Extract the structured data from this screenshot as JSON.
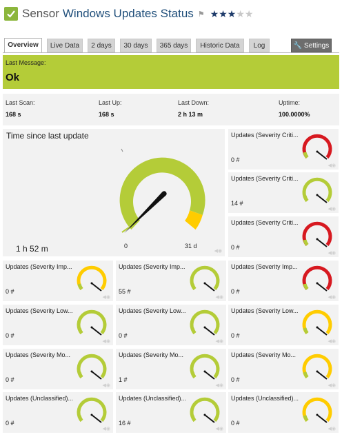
{
  "header": {
    "prefix": "Sensor",
    "name": "Windows Updates Status",
    "stars_filled": 3,
    "stars_total": 5,
    "status": "up",
    "status_color": "#8cb63c"
  },
  "tabs": [
    {
      "label": "Overview",
      "active": true
    },
    {
      "label": "Live Data"
    },
    {
      "label": "2 days"
    },
    {
      "label": "30 days"
    },
    {
      "label": "365 days"
    },
    {
      "label": "Historic Data"
    },
    {
      "label": "Log"
    },
    {
      "label": "Settings",
      "icon": "wrench-icon"
    }
  ],
  "message": {
    "label": "Last Message:",
    "value": "Ok",
    "color": "#b4cc38"
  },
  "stats": {
    "last_scan": {
      "label": "Last Scan:",
      "value": "168 s"
    },
    "last_up": {
      "label": "Last Up:",
      "value": "168 s"
    },
    "last_down": {
      "label": "Last Down:",
      "value": "2 h 13 m"
    },
    "uptime": {
      "label": "Uptime:",
      "value": "100.0000%"
    }
  },
  "main_gauge": {
    "title": "Time since last update",
    "value": "1 h 52 m",
    "scale_min": "0",
    "scale_max": "31 d",
    "colors": {
      "ok": "#b4cc38",
      "warning": "#ffcc00"
    }
  },
  "channels": [
    {
      "title": "Updates (Severity Criti...",
      "value": "0 #",
      "ring": "#d71920"
    },
    {
      "title": "Updates (Severity Criti...",
      "value": "14 #",
      "ring": "#b4cc38"
    },
    {
      "title": "Updates (Severity Criti...",
      "value": "0 #",
      "ring": "#d71920"
    },
    {
      "title": "Updates (Severity Imp...",
      "value": "0 #",
      "ring": "#ffcc00"
    },
    {
      "title": "Updates (Severity Imp...",
      "value": "55 #",
      "ring": "#b4cc38"
    },
    {
      "title": "Updates (Severity Imp...",
      "value": "0 #",
      "ring": "#d71920"
    },
    {
      "title": "Updates (Severity Low...",
      "value": "0 #",
      "ring": "#b4cc38"
    },
    {
      "title": "Updates (Severity Low...",
      "value": "0 #",
      "ring": "#b4cc38"
    },
    {
      "title": "Updates (Severity Low...",
      "value": "0 #",
      "ring": "#ffcc00"
    },
    {
      "title": "Updates (Severity Mo...",
      "value": "0 #",
      "ring": "#b4cc38"
    },
    {
      "title": "Updates (Severity Mo...",
      "value": "1 #",
      "ring": "#b4cc38"
    },
    {
      "title": "Updates (Severity Mo...",
      "value": "0 #",
      "ring": "#ffcc00"
    },
    {
      "title": "Updates (Unclassified)...",
      "value": "0 #",
      "ring": "#b4cc38"
    },
    {
      "title": "Updates (Unclassified)...",
      "value": "16 #",
      "ring": "#b4cc38"
    },
    {
      "title": "Updates (Unclassified)...",
      "value": "0 #",
      "ring": "#ffcc00"
    }
  ]
}
